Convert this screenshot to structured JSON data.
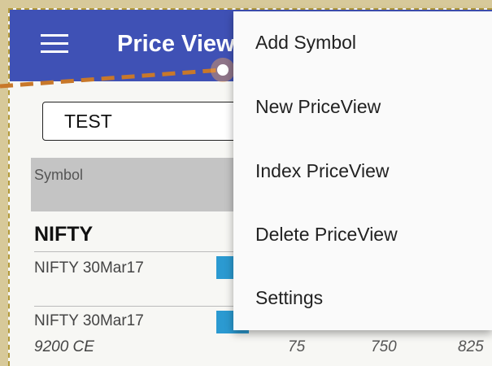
{
  "app": {
    "title": "Price View"
  },
  "search": {
    "value": "TEST"
  },
  "table": {
    "header": "Symbol"
  },
  "group": {
    "title": "NIFTY"
  },
  "rows": [
    {
      "name": "NIFTY 30Mar17",
      "detail": ""
    },
    {
      "name": "NIFTY 30Mar17",
      "detail": "9200 CE",
      "values": [
        "75",
        "750",
        "825"
      ]
    }
  ],
  "menu": {
    "items": [
      "Add Symbol",
      "New PriceView",
      "Index PriceView",
      "Delete PriceView",
      "Settings"
    ]
  },
  "colors": {
    "appbar": "#3f51b5",
    "accent": "#2b9ad1",
    "pointer": "#c8782a"
  }
}
